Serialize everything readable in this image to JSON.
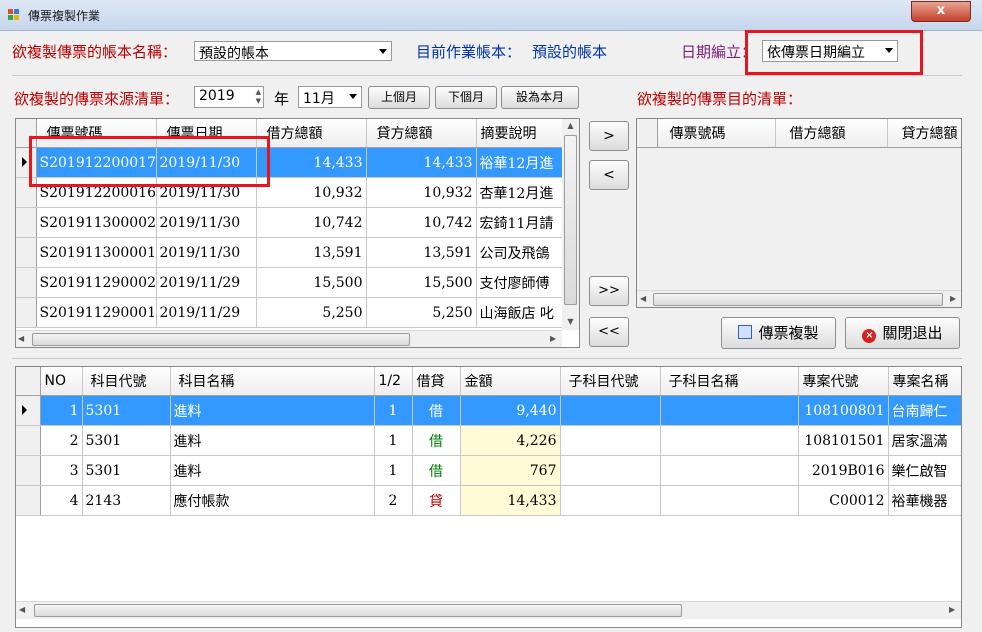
{
  "window": {
    "title": "傳票複製作業",
    "close_symbol": "x"
  },
  "top": {
    "account_label": "欲複製傳票的帳本名稱：",
    "account_value": "預設的帳本",
    "current_account_label": "目前作業帳本：",
    "current_account_value": "預設的帳本",
    "date_label": "日期編立：",
    "date_value": "依傳票日期編立"
  },
  "source": {
    "label": "欲複製的傳票來源清單：",
    "year": "2019",
    "year_unit": "年",
    "month": "11月",
    "prev_month": "上個月",
    "next_month": "下個月",
    "this_month": "設為本月",
    "headers": [
      "傳票號碼",
      "傳票日期",
      "借方總額",
      "貸方總額",
      "摘要說明"
    ],
    "rows": [
      [
        "S201912200017",
        "2019/11/30",
        "14,433",
        "14,433",
        "裕華12月進"
      ],
      [
        "S201912200016",
        "2019/11/30",
        "10,932",
        "10,932",
        "杏華12月進"
      ],
      [
        "S201911300002",
        "2019/11/30",
        "10,742",
        "10,742",
        "宏錡11月請"
      ],
      [
        "S201911300001",
        "2019/11/30",
        "13,591",
        "13,591",
        "公司及飛鴿"
      ],
      [
        "S201911290002",
        "2019/11/29",
        "15,500",
        "15,500",
        "支付廖師傅"
      ],
      [
        "S201911290001",
        "2019/11/29",
        "5,250",
        "5,250",
        "山海飯店 叱"
      ]
    ]
  },
  "transfer": {
    "add": ">",
    "remove": "<",
    "add_all": ">>",
    "remove_all": "<<"
  },
  "target": {
    "label": "欲複製的傳票目的清單：",
    "headers": [
      "傳票號碼",
      "借方總額",
      "貸方總額"
    ]
  },
  "actions": {
    "copy": "傳票複製",
    "close": "關閉退出"
  },
  "detail": {
    "headers": [
      "NO",
      "科目代號",
      "科目名稱",
      "1/2",
      "借貸",
      "金額",
      "子科目代號",
      "子科目名稱",
      "專案代號",
      "專案名稱"
    ],
    "rows": [
      [
        "1",
        "5301",
        "進料",
        "1",
        "借",
        "9,440",
        "",
        "",
        "108100801",
        "台南歸仁"
      ],
      [
        "2",
        "5301",
        "進料",
        "1",
        "借",
        "4,226",
        "",
        "",
        "108101501",
        "居家溫滿"
      ],
      [
        "3",
        "5301",
        "進料",
        "1",
        "借",
        "767",
        "",
        "",
        "2019B016",
        "樂仁啟智"
      ],
      [
        "4",
        "2143",
        "應付帳款",
        "2",
        "貸",
        "14,433",
        "",
        "",
        "C00012",
        "裕華機器"
      ]
    ]
  },
  "colors": {
    "selection": "#3399ff",
    "highlight": "#e8141f",
    "amount_bg": "#fffbd6"
  }
}
